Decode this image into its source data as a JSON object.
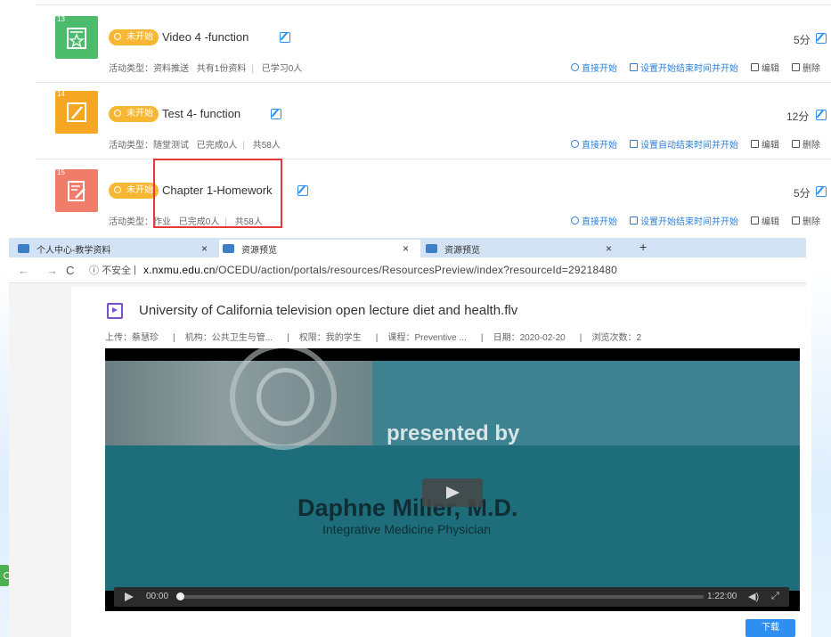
{
  "activities": [
    {
      "number": "13",
      "icon": "star-doc-icon",
      "icon_color": "#4cbb6c",
      "status": "未开始",
      "title": "Video 4 -function",
      "meta": [
        "活动类型：资料推送",
        "共有1份资料",
        "已学习0人"
      ],
      "score": "5分",
      "ops": [
        "直接开始",
        "设置开始结束时间并开始",
        "编辑",
        "删除"
      ]
    },
    {
      "number": "14",
      "icon": "pencil-icon",
      "icon_color": "#f5a623",
      "status": "未开始",
      "title": "Test 4- function",
      "meta": [
        "活动类型：随堂测试",
        "已完成0人",
        "共58人"
      ],
      "score": "12分",
      "ops": [
        "直接开始",
        "设置自动结束时间并开始",
        "编辑",
        "删除"
      ]
    },
    {
      "number": "15",
      "icon": "homework-icon",
      "icon_color": "#f07d6a",
      "status": "未开始",
      "title": "Chapter 1-Homework",
      "meta": [
        "活动类型：作业",
        "已完成0人",
        "共58人"
      ],
      "score": "5分",
      "ops": [
        "直接开始",
        "设置开始结束时间并开始",
        "编辑",
        "删除"
      ]
    }
  ],
  "browser": {
    "tabs": [
      {
        "label": "个人中心-教学资料"
      },
      {
        "label": "资源预览"
      },
      {
        "label": "资源预览"
      }
    ],
    "new_tab": "+",
    "security": "不安全",
    "url_host": "x.nxmu.edu.cn",
    "url_path": "/OCEDU/action/portals/resources/ResourcesPreview/index?resourceId=29218480"
  },
  "preview": {
    "file_title": "University of California television open lecture diet and health.flv",
    "meta": {
      "uploader": "上传：蔡慧珍",
      "org": "机构：公共卫生与管...",
      "permission": "权限：我的学生",
      "course": "课程：Preventive ...",
      "date": "日期：2020-02-20",
      "views": "浏览次数：2"
    },
    "video": {
      "presented_by": "presented by",
      "speaker": "Daphne Miller, M.D.",
      "speaker_title": "Integrative Medicine Physician",
      "current_time": "00:00",
      "total_time": "1:22:00",
      "progress_fraction": 0.0
    },
    "download_label": "下载"
  },
  "colors": {
    "accent_blue": "#2e8ff0",
    "status_orange": "#f7b733",
    "highlight_red": "#e53935"
  }
}
